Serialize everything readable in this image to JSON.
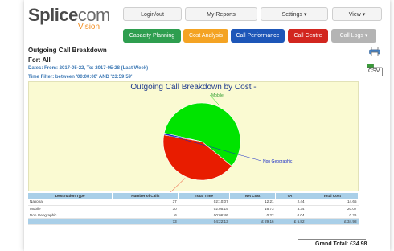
{
  "logo": {
    "brand_bold": "Splice",
    "brand_light": "com",
    "subtitle": "Vision"
  },
  "nav": {
    "login": "Login/out",
    "reports": "My Reports",
    "settings": "Settings ▾",
    "view": "View ▾"
  },
  "tabs": [
    {
      "label": "Capacity Planning",
      "color": "#2e9e4f"
    },
    {
      "label": "Cost Analysis",
      "color": "#f4a323"
    },
    {
      "label": "Call Performance",
      "color": "#1d56b8"
    },
    {
      "label": "Call Centre",
      "color": "#d2261f"
    },
    {
      "label": "Call Logs ▾",
      "color": "#b4b4b4"
    }
  ],
  "side": {
    "csv_label": "CSV"
  },
  "report": {
    "title": "Outgoing Call Breakdown",
    "scope": "For: All",
    "dates": "Dates: From: 2017-05-22, To: 2017-05-28 (Last Week)",
    "time_filter": "Time Filter: between '00:00:00' AND '23:59:59'"
  },
  "chart_data": {
    "type": "pie",
    "title": "Outgoing Call Breakdown by Cost -",
    "slices": [
      {
        "label": "Mobile",
        "value": 20.07,
        "color": "#00e400"
      },
      {
        "label": "National",
        "value": 14.65,
        "color": "#e81c00"
      },
      {
        "label": "Non Geographic",
        "value": 0.26,
        "color": "#1428c8"
      }
    ]
  },
  "table": {
    "headers": [
      "Destination Type",
      "Number of Calls",
      "Total Time",
      "Net Cost",
      "VAT",
      "Total Cost"
    ],
    "rows": [
      [
        "National",
        "37",
        "02:10:07",
        "12.21",
        "2.44",
        "14.65"
      ],
      [
        "Mobile",
        "30",
        "02:05:19",
        "16.73",
        "3.34",
        "20.07"
      ],
      [
        "Non Geographic",
        "6",
        "00:06:46",
        "0.22",
        "0.04",
        "0.26"
      ]
    ],
    "total": [
      "",
      "73",
      "04:22:13",
      "£ 29.16",
      "£ 5.82",
      "£ 34.98"
    ]
  },
  "grand_total": "Grand Total: £34.98"
}
